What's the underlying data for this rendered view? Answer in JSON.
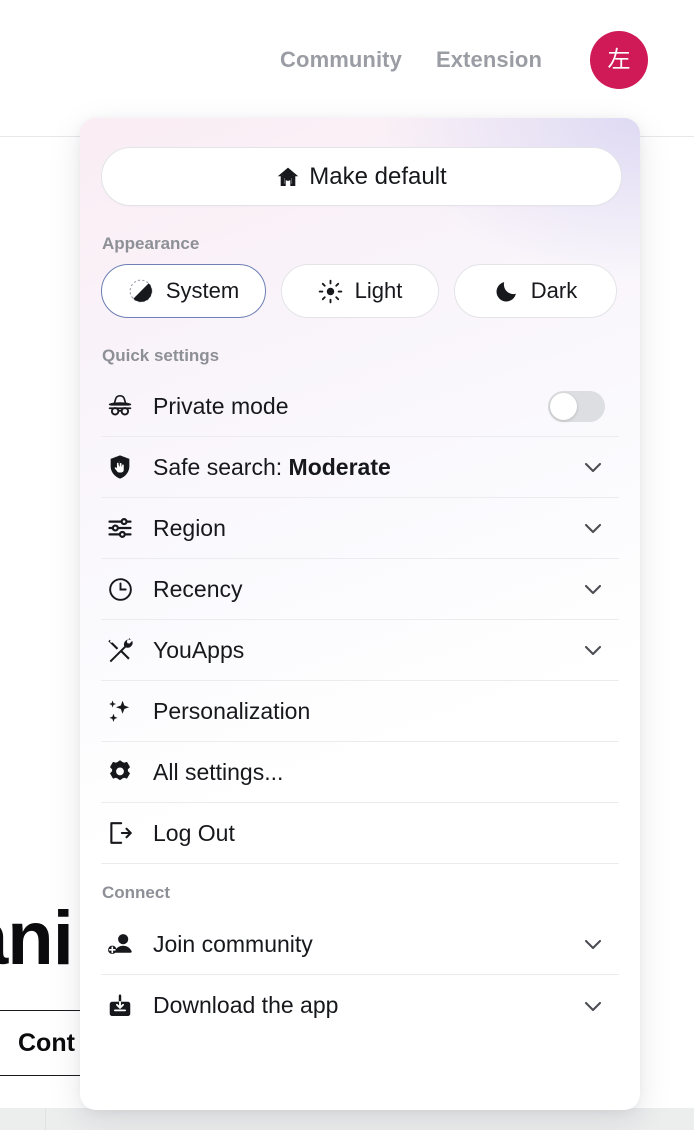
{
  "header": {
    "nav_links": [
      {
        "label": "Community",
        "name": "nav-link-community"
      },
      {
        "label": "Extension",
        "name": "nav-link-extension"
      }
    ],
    "avatar_initial": "左"
  },
  "background": {
    "heading_fragment": "ani",
    "card_label": "Cont"
  },
  "panel": {
    "make_default": {
      "label": "Make default",
      "icon": "home-icon"
    },
    "appearance": {
      "section_label": "Appearance",
      "selected": "System",
      "options": [
        {
          "label": "System",
          "icon": "contrast-circle-icon",
          "selected": true
        },
        {
          "label": "Light",
          "icon": "sun-icon",
          "selected": false
        },
        {
          "label": "Dark",
          "icon": "moon-icon",
          "selected": false
        }
      ]
    },
    "quick_settings": {
      "section_label": "Quick settings",
      "items": [
        {
          "label": "Private mode",
          "icon": "incognito-hat-icon",
          "control": "toggle",
          "toggle_on": false
        },
        {
          "label": "Safe search: ",
          "value": "Moderate",
          "icon": "shield-hand-icon",
          "control": "chevron"
        },
        {
          "label": "Region",
          "icon": "sliders-icon",
          "control": "chevron"
        },
        {
          "label": "Recency",
          "icon": "clock-icon",
          "control": "chevron"
        },
        {
          "label": "YouApps",
          "icon": "tools-icon",
          "control": "chevron"
        },
        {
          "label": "Personalization",
          "icon": "sparkles-icon",
          "control": "none"
        },
        {
          "label": "All settings...",
          "icon": "gear-icon",
          "control": "none"
        },
        {
          "label": "Log Out",
          "icon": "logout-icon",
          "control": "none"
        }
      ]
    },
    "connect": {
      "section_label": "Connect",
      "items": [
        {
          "label": "Join community",
          "icon": "person-add-icon",
          "control": "chevron"
        },
        {
          "label": "Download the app",
          "icon": "download-box-icon",
          "control": "chevron"
        }
      ]
    }
  },
  "colors": {
    "avatar_bg": "#cf1a57",
    "nav_text": "#9b9da4",
    "selected_border": "#6d7fb3",
    "text_primary": "#17181c",
    "text_muted": "#8e9097",
    "divider": "#ececee"
  }
}
